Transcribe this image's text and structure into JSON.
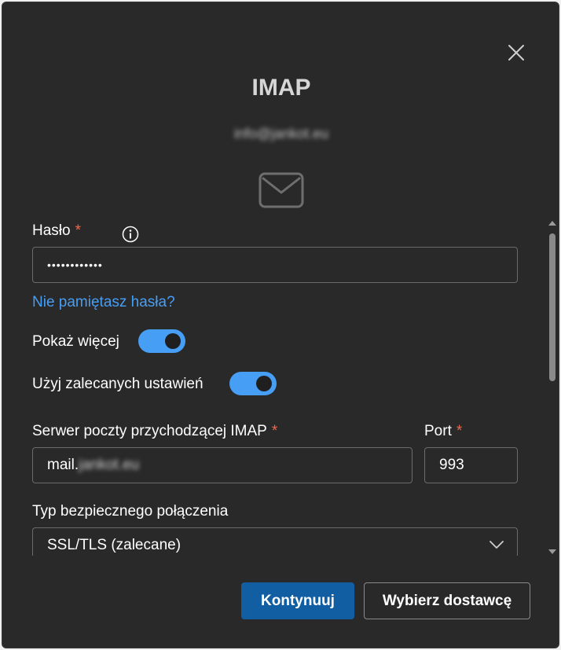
{
  "dialog": {
    "title": "IMAP",
    "account_email": "info@jankot.eu",
    "close_icon": "close-icon",
    "mail_icon": "envelope-icon"
  },
  "form": {
    "password": {
      "label": "Hasło",
      "required_mark": "*",
      "info_icon": "info-icon",
      "value_masked": "••••••••••••"
    },
    "forgot_password_link": "Nie pamiętasz hasła?",
    "show_more": {
      "label": "Pokaż więcej",
      "enabled": true
    },
    "use_recommended": {
      "label": "Użyj zalecanych ustawień",
      "enabled": true
    },
    "incoming_server": {
      "label": "Serwer poczty przychodzącej IMAP",
      "required_mark": "*",
      "value_prefix": "mail.",
      "value_redacted": "jankot.eu"
    },
    "port": {
      "label": "Port",
      "required_mark": "*",
      "value": "993"
    },
    "security_type": {
      "label": "Typ bezpiecznego połączenia",
      "selected": "SSL/TLS (zalecane)"
    }
  },
  "footer": {
    "continue_label": "Kontynuuj",
    "choose_provider_label": "Wybierz dostawcę"
  },
  "colors": {
    "background": "#292929",
    "accent": "#479ef5",
    "primary_button": "#115ea3",
    "required": "#ef6950"
  }
}
